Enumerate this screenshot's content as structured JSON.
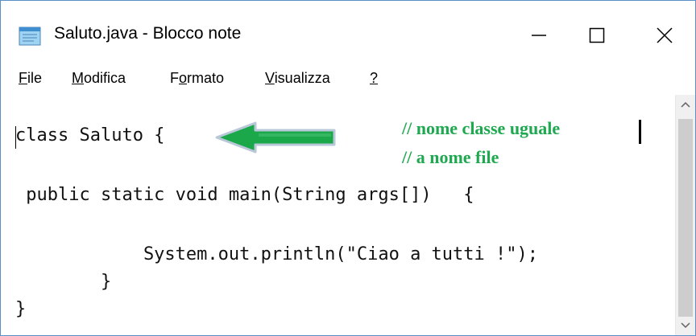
{
  "window": {
    "title": "Saluto.java - Blocco note",
    "app_icon": "notepad-icon",
    "controls": {
      "minimize": "minimize-icon",
      "maximize": "maximize-icon",
      "close": "close-icon"
    }
  },
  "menu": [
    {
      "mnemonic": "F",
      "rest": "ile"
    },
    {
      "mnemonic": "M",
      "rest": "odifica"
    },
    {
      "pre": "F",
      "mnemonic": "o",
      "rest": "rmato"
    },
    {
      "mnemonic": "V",
      "rest": "isualizza"
    },
    {
      "mnemonic": "?",
      "rest": ""
    }
  ],
  "code_lines": [
    "class Saluto {",
    " public static void main(String args[])   {",
    "            System.out.println(\"Ciao a tutti !\");",
    "        }",
    "}"
  ],
  "annotation": {
    "line1": "// nome classe uguale",
    "line2": "// a nome file",
    "arrow_icon": "left-arrow-icon",
    "color": "#1ea84f"
  }
}
